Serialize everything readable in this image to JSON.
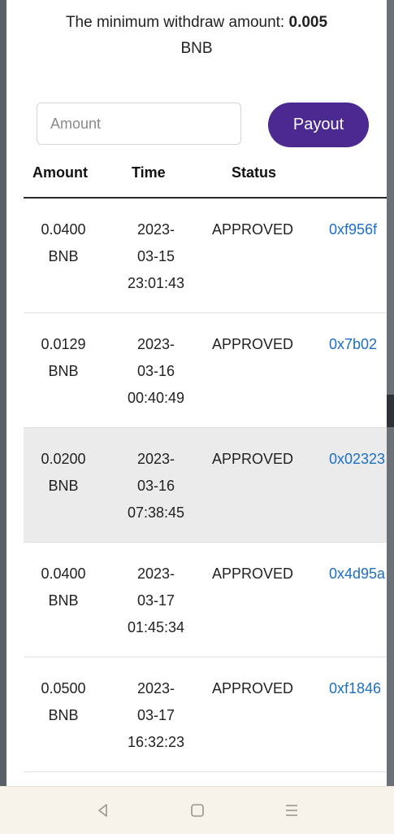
{
  "withdraw": {
    "min_label": "The minimum withdraw amount: ",
    "min_value": "0.005",
    "currency": "BNB"
  },
  "form": {
    "amount_placeholder": "Amount",
    "payout_label": "Payout"
  },
  "table": {
    "headers": {
      "amount": "Amount",
      "time": "Time",
      "status": "Status"
    },
    "rows": [
      {
        "amount": "0.0400",
        "currency": "BNB",
        "date1": "2023-",
        "date2": "03-15",
        "time": "23:01:43",
        "status": "APPROVED",
        "tx": "0xf956f"
      },
      {
        "amount": "0.0129",
        "currency": "BNB",
        "date1": "2023-",
        "date2": "03-16",
        "time": "00:40:49",
        "status": "APPROVED",
        "tx": "0x7b02"
      },
      {
        "amount": "0.0200",
        "currency": "BNB",
        "date1": "2023-",
        "date2": "03-16",
        "time": "07:38:45",
        "status": "APPROVED",
        "tx": "0x02323"
      },
      {
        "amount": "0.0400",
        "currency": "BNB",
        "date1": "2023-",
        "date2": "03-17",
        "time": "01:45:34",
        "status": "APPROVED",
        "tx": "0x4d95a"
      },
      {
        "amount": "0.0500",
        "currency": "BNB",
        "date1": "2023-",
        "date2": "03-17",
        "time": "16:32:23",
        "status": "APPROVED",
        "tx": "0xf1846"
      }
    ]
  },
  "colors": {
    "accent": "#4b2990",
    "link": "#1c6fc4",
    "highlight_row": "#ebebeb"
  },
  "navbar": {
    "icons": [
      "back-icon",
      "home-icon",
      "menu-icon"
    ]
  }
}
